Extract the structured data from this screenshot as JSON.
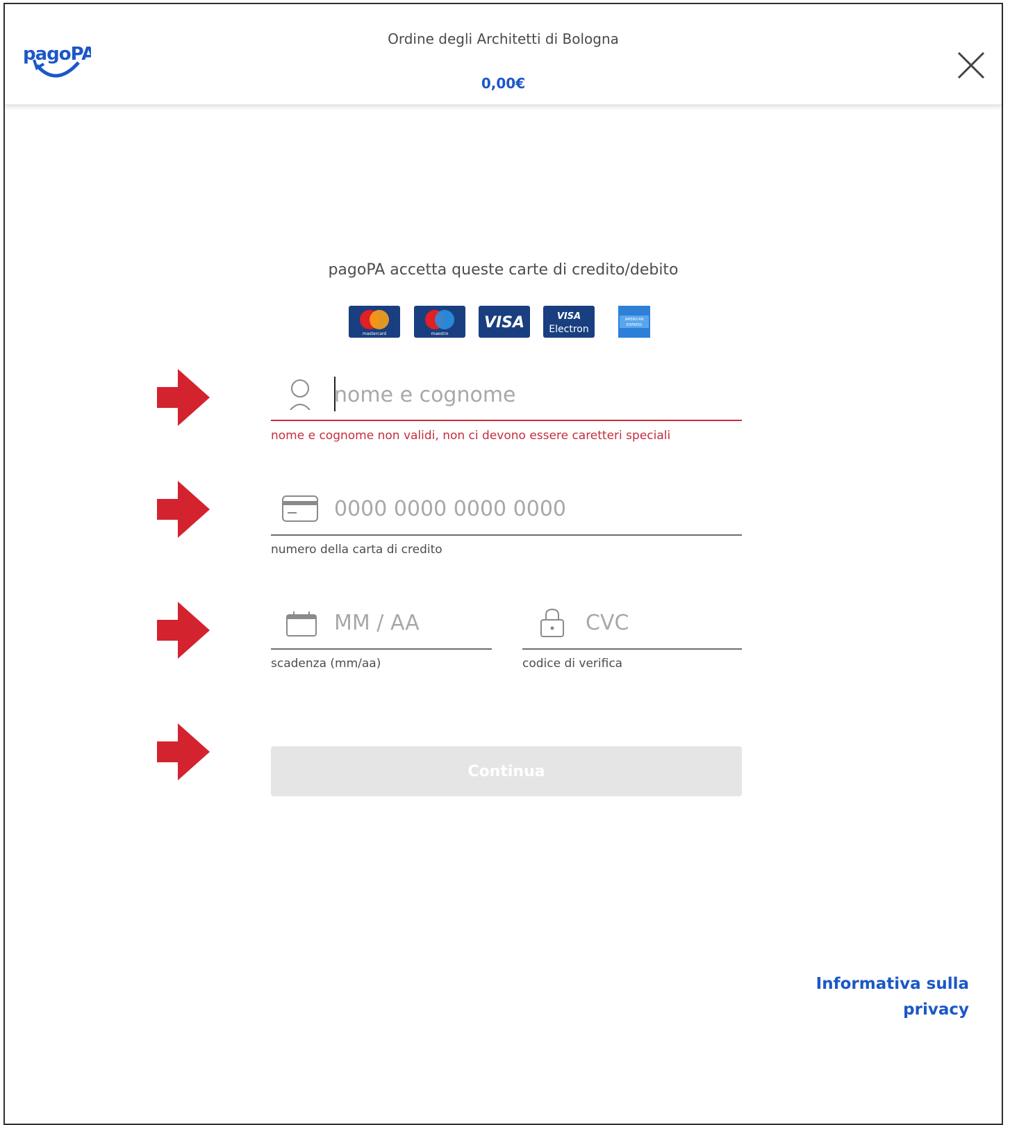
{
  "header": {
    "logo_text": "pagoPA",
    "organization": "Ordine degli Architetti di Bologna",
    "amount": "0,00€"
  },
  "accept_text": "pagoPA accetta queste carte di credito/debito",
  "cards": [
    {
      "name": "mastercard",
      "label": "mastercard"
    },
    {
      "name": "maestro",
      "label": "maestro"
    },
    {
      "name": "visa",
      "label": "VISA"
    },
    {
      "name": "visa-electron",
      "label_top": "VISA",
      "label_bottom": "Electron"
    },
    {
      "name": "american-express",
      "label_top": "AMERICAN",
      "label_bottom": "EXPRESS"
    }
  ],
  "form": {
    "name": {
      "placeholder": "nome e cognome",
      "error": "nome e cognome non validi, non ci devono essere caretteri speciali"
    },
    "card_number": {
      "placeholder": "0000 0000 0000 0000",
      "help": "numero della carta di credito"
    },
    "expiry": {
      "placeholder": "MM / AA",
      "help": "scadenza (mm/aa)"
    },
    "cvc": {
      "placeholder": "CVC",
      "help": "codice di verifica"
    },
    "submit_label": "Continua"
  },
  "privacy_link": {
    "line1": "Informativa sulla",
    "line2": "privacy"
  },
  "colors": {
    "brand_blue": "#1b57c7",
    "error_red": "#c52e3c",
    "arrow_red": "#d3232f",
    "card_blue": "#1a3f80"
  }
}
